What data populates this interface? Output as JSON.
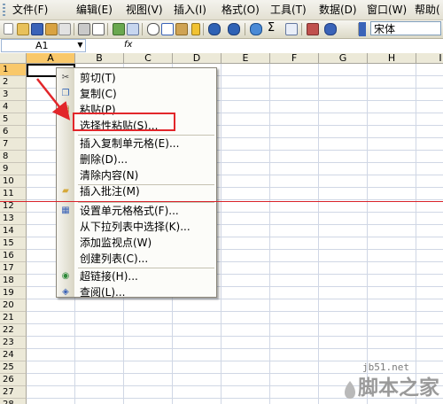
{
  "menubar": {
    "items": [
      {
        "label": "文件(F)"
      },
      {
        "label": "编辑(E)"
      },
      {
        "label": "视图(V)"
      },
      {
        "label": "插入(I)"
      },
      {
        "label": "格式(O)"
      },
      {
        "label": "工具(T)"
      },
      {
        "label": "数据(D)"
      },
      {
        "label": "窗口(W)"
      },
      {
        "label": "帮助("
      }
    ]
  },
  "toolbar": {
    "font_name": "宋体",
    "icons": [
      "new-icon",
      "open-icon",
      "save-icon",
      "permission-icon",
      "email-icon",
      "print-icon",
      "print-preview-icon",
      "spelling-icon",
      "research-icon",
      "cut-icon",
      "copy-icon",
      "paste-icon",
      "format-painter-icon",
      "undo-icon",
      "redo-icon",
      "hyperlink-icon",
      "autosum-icon",
      "sort-ascending-icon",
      "chart-wizard-icon",
      "help-icon"
    ]
  },
  "formula_bar": {
    "name_box": "A1",
    "fx": "fx"
  },
  "sheet": {
    "columns": [
      "A",
      "B",
      "C",
      "D",
      "E",
      "F",
      "G",
      "H",
      "I"
    ],
    "rows": [
      "1",
      "2",
      "3",
      "4",
      "5",
      "6",
      "7",
      "8",
      "9",
      "10",
      "11",
      "12",
      "13",
      "14",
      "15",
      "16",
      "17",
      "18",
      "19",
      "20",
      "21",
      "22",
      "23",
      "24",
      "25",
      "26",
      "27",
      "28"
    ],
    "active_cell": "A1"
  },
  "context_menu": {
    "items": [
      {
        "label": "剪切(T)",
        "icon": "scissors-icon"
      },
      {
        "label": "复制(C)",
        "icon": "copy-icon"
      },
      {
        "label": "粘贴(P)",
        "icon": "paste-icon"
      },
      {
        "label": "选择性粘贴(S)...",
        "icon": ""
      },
      {
        "label": "插入复制单元格(E)...",
        "icon": ""
      },
      {
        "label": "删除(D)...",
        "icon": ""
      },
      {
        "label": "清除内容(N)",
        "icon": ""
      },
      {
        "label": "插入批注(M)",
        "icon": "comment-icon"
      },
      {
        "label": "设置单元格格式(F)...",
        "icon": "format-cells-icon"
      },
      {
        "label": "从下拉列表中选择(K)...",
        "icon": ""
      },
      {
        "label": "添加监视点(W)",
        "icon": ""
      },
      {
        "label": "创建列表(C)...",
        "icon": ""
      },
      {
        "label": "超链接(H)...",
        "icon": "hyperlink-icon"
      },
      {
        "label": "查阅(L)...",
        "icon": "lookup-icon"
      }
    ]
  },
  "watermark": {
    "url": "jb51.net",
    "name": "脚本之家"
  }
}
